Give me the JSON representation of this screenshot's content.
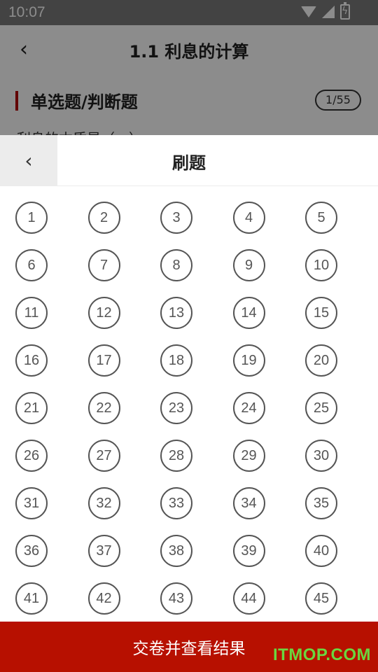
{
  "status_bar": {
    "time": "10:07",
    "icons": [
      "wifi-icon",
      "signal-icon",
      "battery-charging-icon"
    ]
  },
  "header": {
    "back_icon": "chevron-left-icon",
    "title": "1.1 利息的计算"
  },
  "section": {
    "title": "单选题/判断题",
    "progress": "1/55",
    "question_peek": "利息的本质是（　）。"
  },
  "sheet": {
    "back_icon": "chevron-left-icon",
    "title": "刷题",
    "questions": [
      "1",
      "2",
      "3",
      "4",
      "5",
      "6",
      "7",
      "8",
      "9",
      "10",
      "11",
      "12",
      "13",
      "14",
      "15",
      "16",
      "17",
      "18",
      "19",
      "20",
      "21",
      "22",
      "23",
      "24",
      "25",
      "26",
      "27",
      "28",
      "29",
      "30",
      "31",
      "32",
      "33",
      "34",
      "35",
      "36",
      "37",
      "38",
      "39",
      "40",
      "41",
      "42",
      "43",
      "44",
      "45"
    ]
  },
  "submit": {
    "label": "交卷并查看结果"
  },
  "watermark": "ITMOP.COM",
  "colors": {
    "accent": "#b71000",
    "section_marker": "#b30000",
    "watermark": "#6bd63f"
  }
}
